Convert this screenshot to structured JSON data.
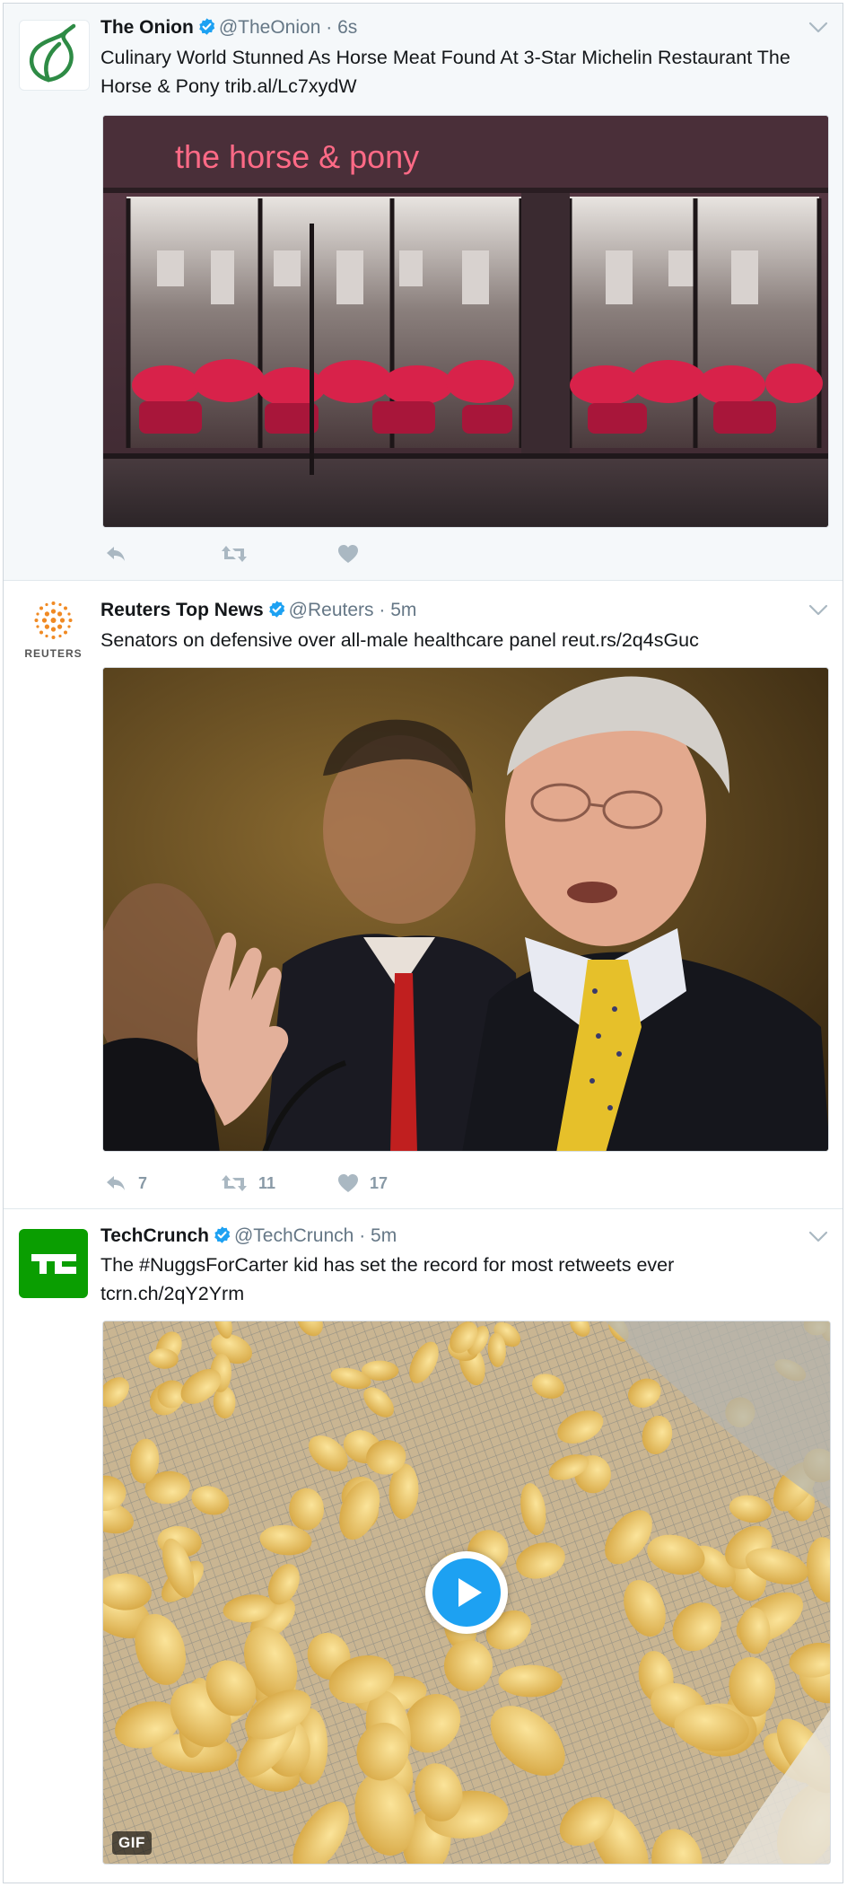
{
  "colors": {
    "accent": "#1da1f2",
    "muted": "#657786",
    "onion_green": "#2e8b45",
    "techcrunch_green": "#0a9e01",
    "reuters_orange": "#f08a24"
  },
  "tweets": [
    {
      "name": "The Onion",
      "handle": "@TheOnion",
      "sep": "·",
      "time": "6s",
      "text": "Culinary World Stunned As Horse Meat Found At 3-Star Michelin Restaurant The Horse & Pony trib.al/Lc7xydW",
      "image_sign": "the horse & pony",
      "avatar_icon": "onion-logo-icon",
      "reply_count": "",
      "retweet_count": "",
      "like_count": ""
    },
    {
      "name": "Reuters Top News",
      "handle": "@Reuters",
      "sep": "·",
      "time": "5m",
      "text": "Senators on defensive over all-male healthcare panel reut.rs/2q4sGuc",
      "avatar_label": "REUTERS",
      "avatar_icon": "reuters-logo-icon",
      "reply_count": "7",
      "retweet_count": "11",
      "like_count": "17"
    },
    {
      "name": "TechCrunch",
      "handle": "@TechCrunch",
      "sep": "·",
      "time": "5m",
      "text": "The #NuggsForCarter kid has set the record for most retweets ever tcrn.ch/2qY2Yrm",
      "avatar_icon": "techcrunch-logo-icon",
      "media_badge": "GIF"
    }
  ]
}
